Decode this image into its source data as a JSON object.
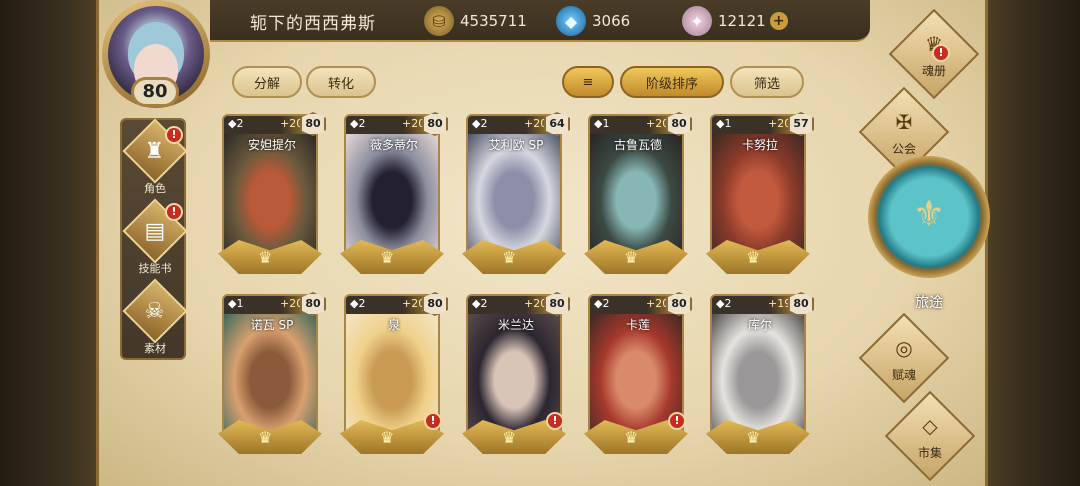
{
  "player": {
    "name": "轭下的西西弗斯",
    "level": "80"
  },
  "resources": {
    "gold": "4535711",
    "crystal": "3066",
    "gem": "12121",
    "gold_icon": "coin-icon",
    "crystal_icon": "crystal-icon",
    "gem_icon": "gem-icon",
    "plus": "+"
  },
  "toolbar": {
    "decompose": "分解",
    "convert": "转化",
    "sort_icon": "≡",
    "sort": "阶级排序",
    "filter": "筛选"
  },
  "leftnav": [
    {
      "label": "角色",
      "icon": "helmet-icon"
    },
    {
      "label": "技能书",
      "icon": "book-icon"
    },
    {
      "label": "素材",
      "icon": "skull-icon"
    }
  ],
  "rightnav": {
    "soulbook": "魂册",
    "guild": "公会",
    "journey": "旅途",
    "talent": "赋魂",
    "market": "市集"
  },
  "alert_mark": "!",
  "cards": [
    {
      "name": "安妲提尔",
      "stars": "◆2",
      "bonus": "+20",
      "level": "80",
      "alert": false,
      "palette": [
        "#6b5a3d",
        "#b95a38",
        "#2b2a25"
      ]
    },
    {
      "name": "薇多蒂尔",
      "stars": "◆2",
      "bonus": "+20",
      "level": "80",
      "alert": false,
      "palette": [
        "#8d8fa0",
        "#222031",
        "#e4d8d6"
      ]
    },
    {
      "name": "艾利欧 SP",
      "stars": "◆2",
      "bonus": "+20",
      "level": "64",
      "alert": false,
      "palette": [
        "#d5d7e0",
        "#8d8fa8",
        "#4d5065"
      ]
    },
    {
      "name": "古鲁瓦德",
      "stars": "◆1",
      "bonus": "+20",
      "level": "80",
      "alert": false,
      "palette": [
        "#3c4a44",
        "#86b6b5",
        "#2a2522"
      ]
    },
    {
      "name": "卡努拉",
      "stars": "◆1",
      "bonus": "+20",
      "level": "57",
      "alert": false,
      "palette": [
        "#8b3a2a",
        "#c25a3e",
        "#3b2a22"
      ]
    },
    {
      "name": "诺瓦 SP",
      "stars": "◆1",
      "bonus": "+20",
      "level": "80",
      "alert": false,
      "palette": [
        "#d9a070",
        "#8a5a3a",
        "#3d6a5a"
      ]
    },
    {
      "name": "泉",
      "stars": "◆2",
      "bonus": "+20",
      "level": "80",
      "alert": true,
      "palette": [
        "#efd08a",
        "#c89a52",
        "#f4e6c8"
      ]
    },
    {
      "name": "米兰达",
      "stars": "◆2",
      "bonus": "+20",
      "level": "80",
      "alert": true,
      "palette": [
        "#2c2630",
        "#d9c4b8",
        "#5a4b4a"
      ]
    },
    {
      "name": "卡莲",
      "stars": "◆2",
      "bonus": "+20",
      "level": "80",
      "alert": true,
      "palette": [
        "#a6382c",
        "#d98a6a",
        "#3a2a24"
      ]
    },
    {
      "name": "库尔",
      "stars": "◆2",
      "bonus": "+19",
      "level": "80",
      "alert": false,
      "palette": [
        "#e6e3df",
        "#9a9898",
        "#4d4a4a"
      ]
    }
  ]
}
